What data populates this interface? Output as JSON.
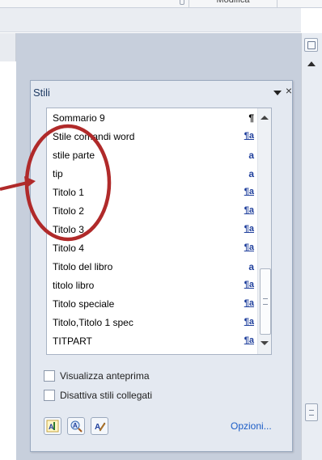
{
  "ribbon": {
    "group_label": "Modifica"
  },
  "document": {
    "text_fragment": "eg"
  },
  "pane": {
    "title": "Stili",
    "close_symbol": "×",
    "options_label": "Opzioni...",
    "styles": [
      {
        "name": "Sommario 9",
        "type_glyph": "¶",
        "type": "paragraph"
      },
      {
        "name": "Stile comandi word",
        "type_glyph": "¶a",
        "type": "linked"
      },
      {
        "name": "stile parte",
        "type_glyph": "a",
        "type": "character"
      },
      {
        "name": "tip",
        "type_glyph": "a",
        "type": "character"
      },
      {
        "name": "Titolo 1",
        "type_glyph": "¶a",
        "type": "linked"
      },
      {
        "name": "Titolo 2",
        "type_glyph": "¶a",
        "type": "linked"
      },
      {
        "name": "Titolo 3",
        "type_glyph": "¶a",
        "type": "linked"
      },
      {
        "name": "Titolo 4",
        "type_glyph": "¶a",
        "type": "linked"
      },
      {
        "name": "Titolo del libro",
        "type_glyph": "a",
        "type": "character"
      },
      {
        "name": "titolo libro",
        "type_glyph": "¶a",
        "type": "linked"
      },
      {
        "name": "Titolo speciale",
        "type_glyph": "¶a",
        "type": "linked"
      },
      {
        "name": "Titolo,Titolo 1 spec",
        "type_glyph": "¶a",
        "type": "linked"
      },
      {
        "name": "TITPART",
        "type_glyph": "¶a",
        "type": "linked"
      }
    ],
    "checkboxes": [
      {
        "label": "Visualizza anteprima",
        "checked": false
      },
      {
        "label": "Disattiva stili collegati",
        "checked": false
      }
    ],
    "buttons": [
      "new-style",
      "style-inspector",
      "manage-styles"
    ]
  },
  "colors": {
    "pane_bg": "#e4e9f1",
    "annotation": "#b02a2a",
    "link": "#1b5cc6"
  }
}
